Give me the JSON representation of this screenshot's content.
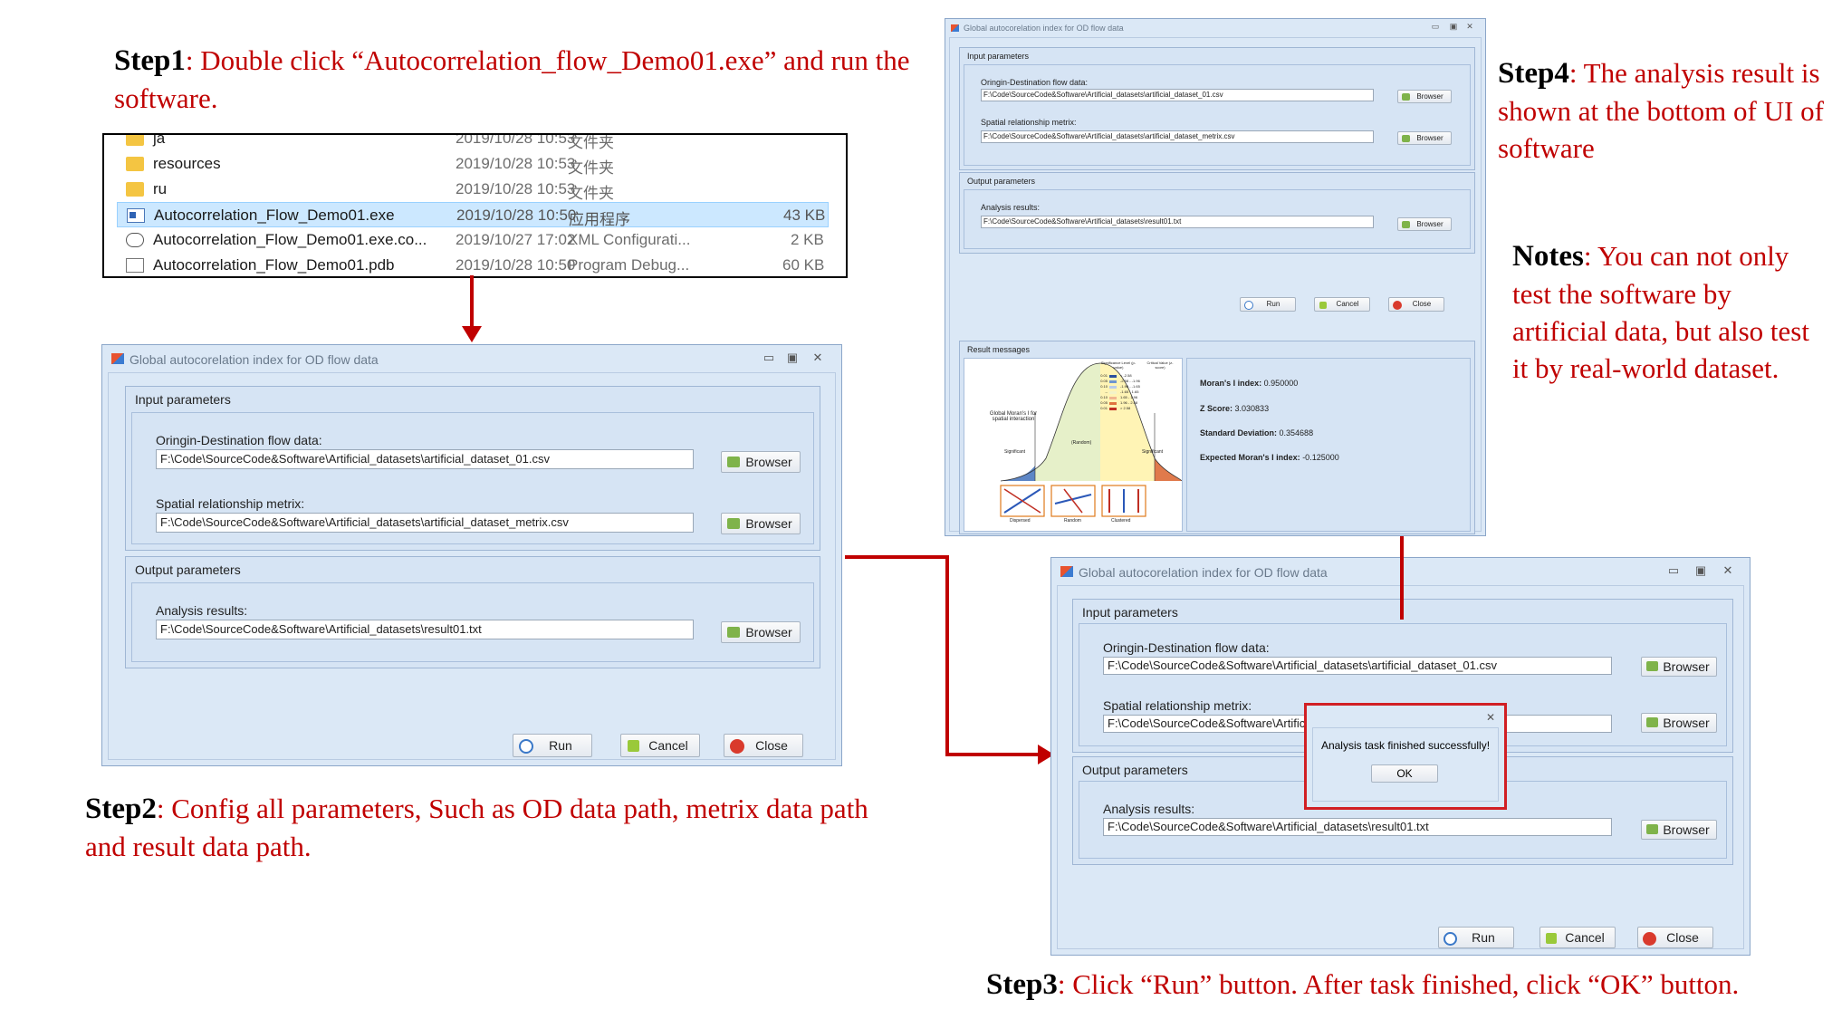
{
  "steps": {
    "step1": {
      "label": "Step1",
      "text": ": Double click “Autocorrelation_flow_Demo01.exe” and run the software."
    },
    "step2": {
      "label": "Step2",
      "text": ": Config all parameters, Such as OD data path, metrix data path and result data path."
    },
    "step3": {
      "label": "Step3",
      "text": ": Click “Run” button. After task finished, click “OK” button."
    },
    "step4": {
      "label": "Step4",
      "text": ": The analysis result is shown at the bottom of UI of software"
    },
    "notes": {
      "label": "Notes",
      "text": ": You can not only test the software by artificial data, but also test it by real-world dataset."
    }
  },
  "explorer": {
    "rows": [
      {
        "name": "ja",
        "date": "2019/10/28 10:53",
        "type": "文件夹",
        "size": "",
        "icon": "folder-icon"
      },
      {
        "name": "resources",
        "date": "2019/10/28 10:53",
        "type": "文件夹",
        "size": "",
        "icon": "folder-icon"
      },
      {
        "name": "ru",
        "date": "2019/10/28 10:53",
        "type": "文件夹",
        "size": "",
        "icon": "folder-icon"
      },
      {
        "name": "Autocorrelation_Flow_Demo01.exe",
        "date": "2019/10/28 10:50",
        "type": "应用程序",
        "size": "43 KB",
        "icon": "exe-icon"
      },
      {
        "name": "Autocorrelation_Flow_Demo01.exe.co...",
        "date": "2019/10/27 17:02",
        "type": "XML Configurati...",
        "size": "2 KB",
        "icon": "config-icon"
      },
      {
        "name": "Autocorrelation_Flow_Demo01.pdb",
        "date": "2019/10/28 10:50",
        "type": "Program Debug...",
        "size": "60 KB",
        "icon": "pdb-icon"
      }
    ]
  },
  "dialog": {
    "title": "Global autocorelation index for OD flow data",
    "input_group": "Input parameters",
    "od_label": "Oringin-Destination flow data:",
    "od_value": "F:\\Code\\SourceCode&Software\\Artificial_datasets\\artificial_dataset_01.csv",
    "spatial_label": "Spatial relationship metrix:",
    "spatial_value": "F:\\Code\\SourceCode&Software\\Artificial_datasets\\artificial_dataset_metrix.csv",
    "spatial_value_truncated": "F:\\Code\\SourceCode&Software\\Artificia",
    "output_group": "Output parameters",
    "result_label": "Analysis results:",
    "result_value": "F:\\Code\\SourceCode&Software\\Artificial_datasets\\result01.txt",
    "browser": "Browser",
    "run": "Run",
    "cancel": "Cancel",
    "close": "Close",
    "result_group": "Result messages"
  },
  "message_box": {
    "text": "Analysis task finished successfully!",
    "ok": "OK"
  },
  "results": {
    "morans_i_label": "Moran's I index:",
    "morans_i": "0.950000",
    "z_label": "Z Score:",
    "z": "3.030833",
    "sd_label": "Standard Deviation:",
    "sd": "0.354688",
    "exp_label": "Expected Moran's I index:",
    "exp": "-0.125000"
  },
  "figure": {
    "curve_caption": "Global Moran's I for spatial interaction",
    "sig_header": "Significance Level (p-value)",
    "crit_header": "Critical Value (z-score)",
    "levels": [
      "0.01",
      "0.05",
      "0.10",
      "--",
      "0.10",
      "0.05",
      "0.01"
    ],
    "crit": [
      "< -2.58",
      "-2.58 - -1.96",
      "-1.96 - -1.65",
      "-1.65 - 1.65",
      "1.65 - 1.96",
      "1.96 - 2.58",
      "> 2.58"
    ],
    "left_tag": "Significant",
    "mid_tag": "(Random)",
    "right_tag": "Significant",
    "panel_labels": [
      "Dispersed",
      "Random",
      "Clustered"
    ]
  },
  "colors": {
    "accent": "#c00000",
    "window": "#dbe8f6",
    "group": "#d6e4f4",
    "selection": "#cce8ff"
  }
}
